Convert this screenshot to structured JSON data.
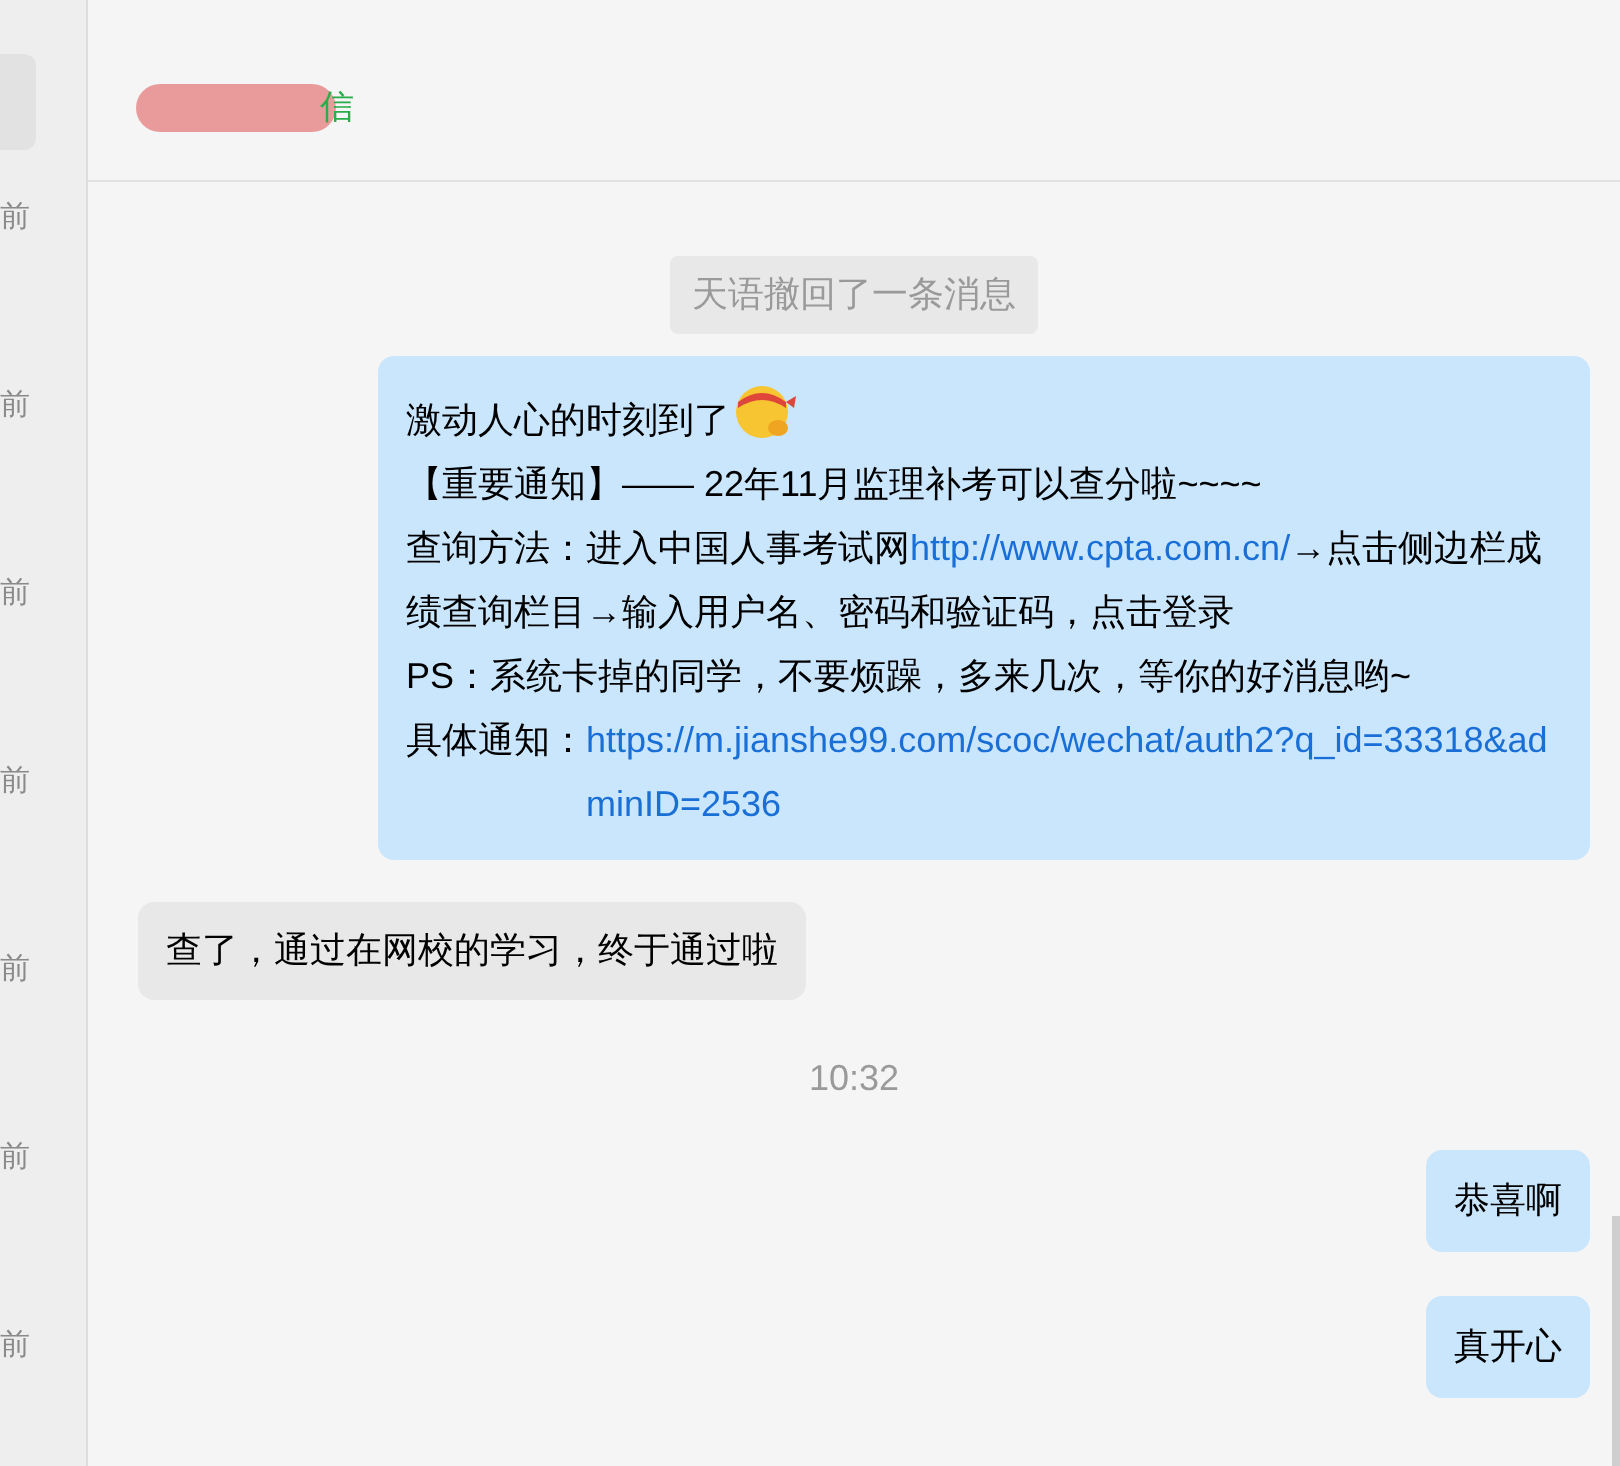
{
  "sidebar": {
    "times": [
      "前",
      "前",
      "前",
      "前",
      "前",
      "前",
      "前"
    ]
  },
  "header": {
    "title_suffix": "信"
  },
  "messages": [
    {
      "kind": "notice",
      "text": "天语撤回了一条消息"
    },
    {
      "kind": "outgoing",
      "paragraphs": [
        [
          {
            "kind": "text",
            "text": "激动人心的时刻到了"
          },
          {
            "kind": "emoji"
          }
        ],
        [
          {
            "kind": "text",
            "text": "【重要通知】—— 22年11月监理补考可以查分啦~~~~"
          }
        ],
        [
          {
            "kind": "text",
            "text": "查询方法：进入中国人事考试网"
          },
          {
            "kind": "link",
            "text": "http://www.cpta.com.cn/"
          },
          {
            "kind": "text",
            "text": "→点击侧边栏成绩查询栏目→输入用户名、密码和验证码，点击登录"
          }
        ],
        [
          {
            "kind": "text",
            "text": "PS：系统卡掉的同学，不要烦躁，多来几次，等你的好消息哟~"
          }
        ],
        [
          {
            "kind": "text",
            "text": "具体通知："
          },
          {
            "kind": "block_link",
            "text": "https://m.jianshe99.com/scoc/wechat/auth2?q_id=33318&adminID=2536"
          }
        ]
      ]
    },
    {
      "kind": "incoming",
      "text": "查了，通过在网校的学习，终于通过啦"
    },
    {
      "kind": "time",
      "text": "10:32"
    },
    {
      "kind": "outgoing",
      "text": "恭喜啊"
    },
    {
      "kind": "outgoing",
      "text": "真开心"
    }
  ]
}
